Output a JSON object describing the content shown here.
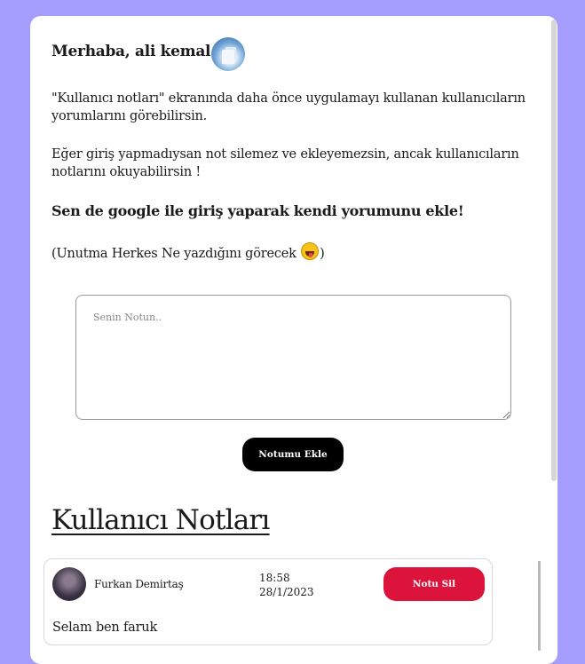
{
  "header": {
    "greeting": "Merhaba, ali kemal"
  },
  "intro": {
    "paragraph1": "\"Kullanıcı notları\" ekranında daha önce uygulamayı kullanan kullanıcıların yorumlarını görebilirsin.",
    "paragraph2": "Eğer giriş yapmadıysan not silemez ve ekleyemezsin, ancak kullanıcıların notlarını okuyabilirsin !",
    "cta": "Sen de google ile giriş yaparak kendi yorumunu ekle!",
    "reminder_prefix": "(Unutma Herkes Ne yazdığını görecek ",
    "reminder_suffix": ")"
  },
  "form": {
    "placeholder": "Senin Notun..",
    "value": "",
    "add_button": "Notumu Ekle"
  },
  "notes_section": {
    "title": "Kullanıcı Notları",
    "notes": [
      {
        "author": "Furkan Demirtaş",
        "time": "18:58",
        "date": "28/1/2023",
        "delete_button": "Notu Sil",
        "text": "Selam ben faruk"
      }
    ]
  },
  "colors": {
    "background": "#a59dfb",
    "primary_button": "#000000",
    "delete_button": "#dc143c"
  }
}
